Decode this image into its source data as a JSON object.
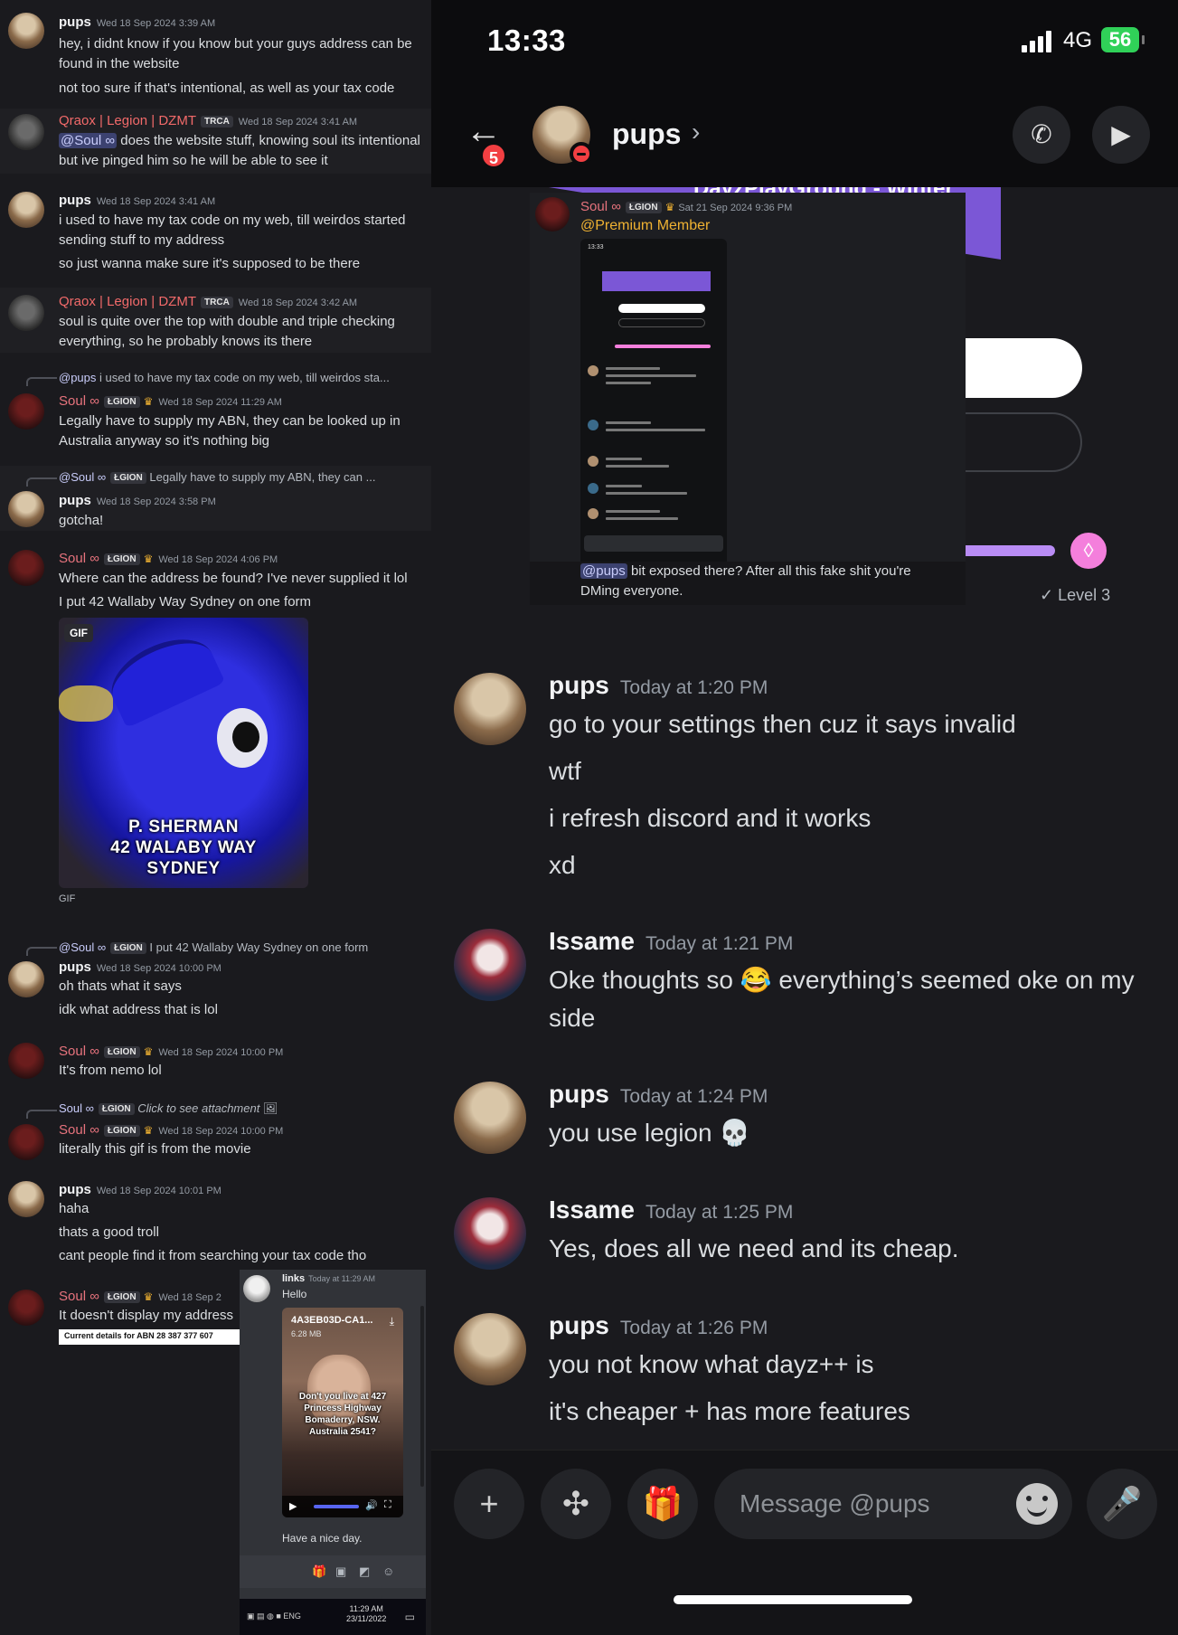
{
  "left": {
    "messages": [
      {
        "author": "pups",
        "time": "Wed 18 Sep 2024 3:39 AM",
        "lines": [
          "hey, i didnt know if you know but your guys address can be found in the website",
          "not too sure if that's intentional, as well as your tax code"
        ]
      },
      {
        "author": "Qraox | Legion | DZMT",
        "tag": "TRCA",
        "time": "Wed 18 Sep 2024 3:41 AM",
        "mention": "@Soul ∞",
        "lines": [
          "does the website stuff, knowing soul its intentional but ive pinged him so he will be able to see it"
        ]
      },
      {
        "author": "pups",
        "time": "Wed 18 Sep 2024 3:41 AM",
        "lines": [
          "i used to have my tax code on my web, till weirdos started sending stuff to my address",
          "so just wanna make sure it's supposed to be there"
        ]
      },
      {
        "author": "Qraox | Legion | DZMT",
        "tag": "TRCA",
        "time": "Wed 18 Sep 2024 3:42 AM",
        "lines": [
          "soul is quite over the top with double and triple checking everything, so he probably knows its there"
        ]
      },
      {
        "reply_name": "@pups",
        "reply_text": "i used to have my tax code on my web, till weirdos sta...",
        "author": "Soul ∞",
        "tag": "ŁGION",
        "time": "Wed 18 Sep 2024 11:29 AM",
        "lines": [
          "Legally have to supply my ABN, they can be looked up in Australia anyway so it's nothing big"
        ]
      },
      {
        "reply_name": "@Soul ∞",
        "reply_tag": "ŁGION",
        "reply_text": "Legally have to supply my ABN, they can ...",
        "author": "pups",
        "time": "Wed 18 Sep 2024 3:58 PM",
        "lines": [
          "gotcha!"
        ]
      },
      {
        "author": "Soul ∞",
        "tag": "ŁGION",
        "time": "Wed 18 Sep 2024 4:06 PM",
        "lines": [
          "Where can the address be found? I've never supplied it lol",
          "I put 42 Wallaby Way Sydney on one form"
        ]
      },
      {
        "reply_name": "@Soul ∞",
        "reply_tag": "ŁGION",
        "reply_text": "I put 42 Wallaby Way Sydney on one form",
        "author": "pups",
        "time": "Wed 18 Sep 2024 10:00 PM",
        "lines": [
          "oh thats what it says",
          "idk what address that is lol"
        ]
      },
      {
        "author": "Soul ∞",
        "tag": "ŁGION",
        "time": "Wed 18 Sep 2024 10:00 PM",
        "lines": [
          "It's from nemo lol"
        ]
      },
      {
        "reply_name": "Soul ∞",
        "reply_tag": "ŁGION",
        "reply_text": "Click to see attachment",
        "author": "Soul ∞",
        "tag": "ŁGION",
        "time": "Wed 18 Sep 2024 10:00 PM",
        "lines": [
          "literally this gif is from the movie"
        ]
      },
      {
        "author": "pups",
        "time": "Wed 18 Sep 2024 10:01 PM",
        "lines": [
          "haha",
          "thats a good troll",
          "cant people find it from searching your tax code tho"
        ]
      },
      {
        "author": "Soul ∞",
        "tag": "ŁGION",
        "time": "Wed 18 Sep 2",
        "lines": [
          "It doesn't display my address"
        ]
      }
    ],
    "gif": {
      "badge": "GIF",
      "caption": [
        "P. SHERMAN",
        "42 WALABY WAY",
        "SYDNEY"
      ],
      "label": "GIF"
    },
    "abn_label": "Current details for ABN 28 387 377 607"
  },
  "popup": {
    "author": "links",
    "time": "Today at 11:29 AM",
    "text": "Hello",
    "file_name": "4A3EB03D-CA1...",
    "file_size": "6.28 MB",
    "video_caption": "Don't you live at 427 Princess Highway Bomaderry, NSW. Australia 2541?",
    "footer": "Have a nice day.",
    "taskbar": {
      "lang": "ENG",
      "time": "11:29 AM",
      "date": "23/11/2022"
    }
  },
  "status": {
    "time": "13:33",
    "network": "4G",
    "battery": "56"
  },
  "header": {
    "name": "pups",
    "badge": "5"
  },
  "banner_text": "DayzPlayGround - Winter",
  "level_label": "✓ Level 3",
  "screenshot_msg": {
    "author": "Soul ∞",
    "tag": "ŁGION",
    "time": "Sat 21 Sep 2024 9:36 PM",
    "mention": "@Premium Member",
    "mini_time": "13:33",
    "reply_mention": "@pups",
    "reply_text": "bit exposed there? After all this fake shit you're DMing everyone."
  },
  "messages": [
    {
      "author": "pups",
      "time": "Today at 1:20 PM",
      "lines": [
        "go to your settings then cuz it says invalid",
        "wtf",
        "i refresh discord and it works",
        "xd"
      ]
    },
    {
      "author": "Issame",
      "time": "Today at 1:21 PM",
      "lines": [
        "Oke thoughts so 😂 everything’s seemed oke on my side"
      ]
    },
    {
      "author": "pups",
      "time": "Today at 1:24 PM",
      "lines": [
        "you use legion 💀"
      ]
    },
    {
      "author": "Issame",
      "time": "Today at 1:25 PM",
      "lines": [
        "Yes, does all we need and its cheap."
      ]
    },
    {
      "author": "pups",
      "time": "Today at 1:26 PM",
      "lines": [
        "you not know what dayz++ is",
        "it's cheaper + has more features"
      ]
    }
  ],
  "input": {
    "placeholder": "Message @pups"
  },
  "colors": {
    "accent": "#5865f2",
    "danger": "#f23f42",
    "battery": "#30d158",
    "level": "#f47fdc"
  }
}
